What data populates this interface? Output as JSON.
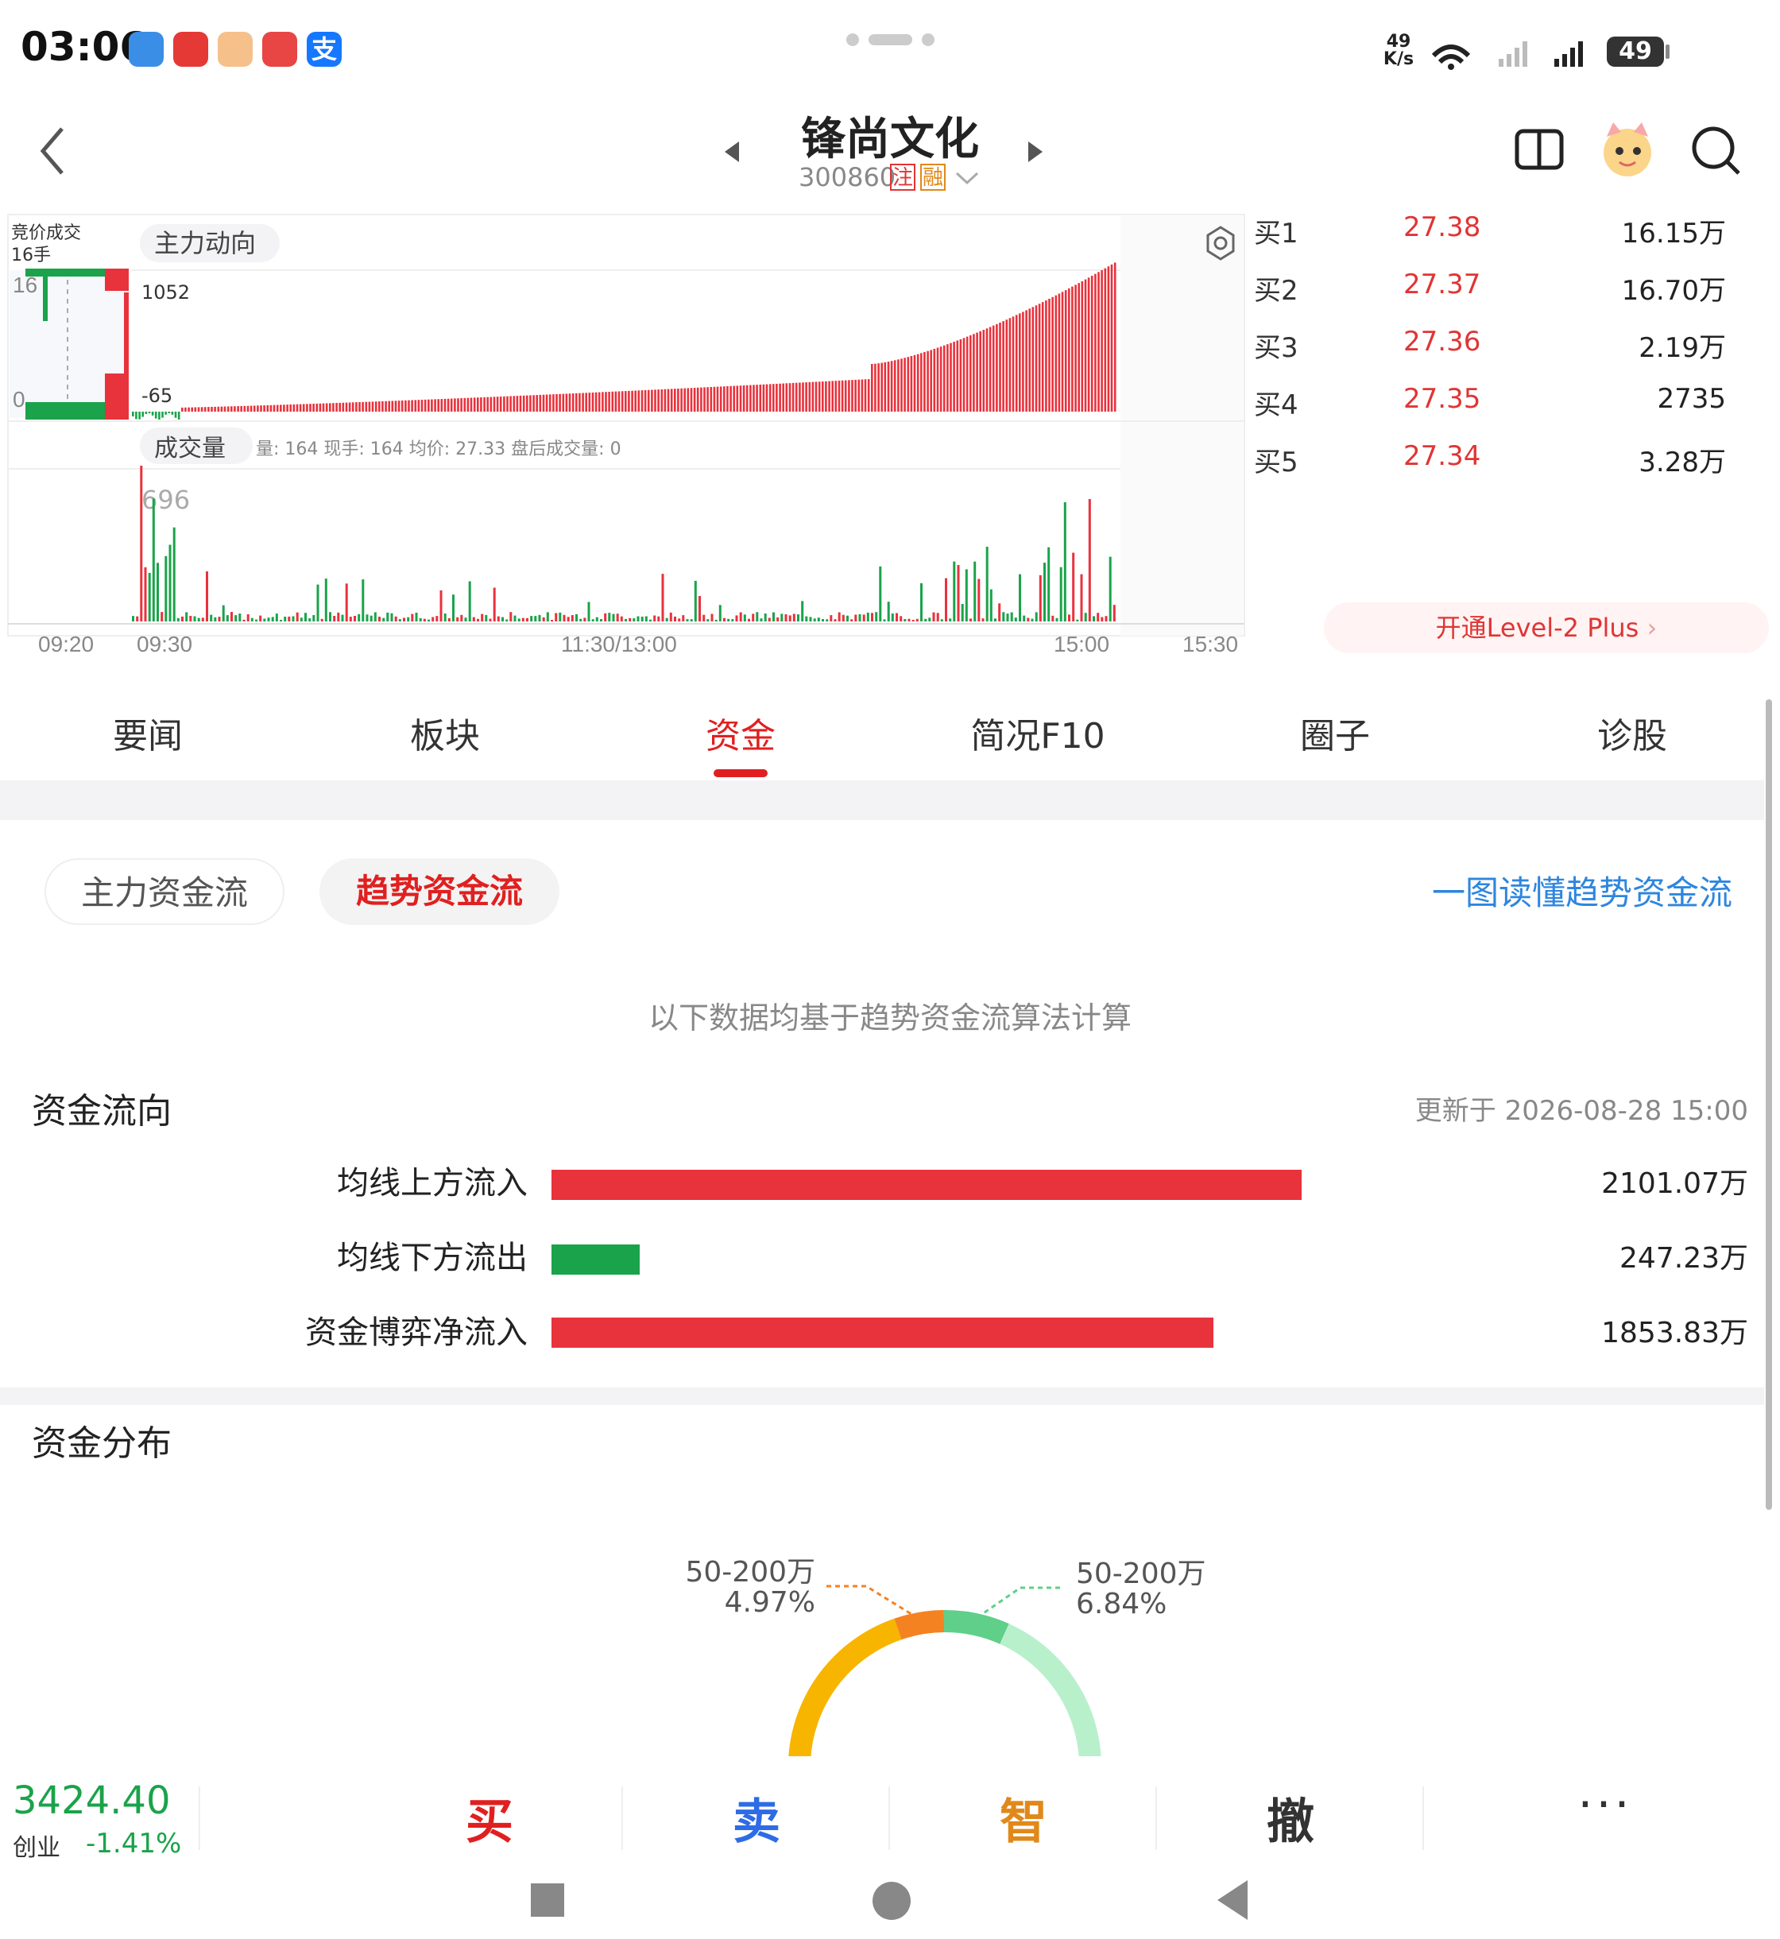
{
  "status_bar": {
    "time": "03:06",
    "net_speed": "49 K/s",
    "battery": "49"
  },
  "header": {
    "stock_name": "锋尚文化",
    "stock_code": "300860",
    "tag_zhu": "注",
    "tag_rong": "融"
  },
  "chart": {
    "auction_label": "竞价成交",
    "auction_volume": "16手",
    "main_flow_label": "主力动向",
    "left_max": "16",
    "left_min": "0",
    "flow_max": "1052",
    "flow_min": "-65",
    "volume_label": "成交量",
    "volume_info": "量: 164 现手: 164 均价: 27.33 盘后成交量: 0",
    "volume_max": "696",
    "time_ticks": [
      "09:20",
      "09:30",
      "11:30/13:00",
      "15:00",
      "15:30"
    ]
  },
  "order_book": [
    {
      "label": "买1",
      "price": "27.38",
      "volume": "16.15万"
    },
    {
      "label": "买2",
      "price": "27.37",
      "volume": "16.70万"
    },
    {
      "label": "买3",
      "price": "27.36",
      "volume": "2.19万"
    },
    {
      "label": "买4",
      "price": "27.35",
      "volume": "2735"
    },
    {
      "label": "买5",
      "price": "27.34",
      "volume": "3.28万"
    }
  ],
  "level2_button": "开通Level-2 Plus",
  "tabs": [
    "要闻",
    "板块",
    "资金",
    "简况F10",
    "圈子",
    "诊股"
  ],
  "active_tab": "资金",
  "toggle": {
    "main_flow": "主力资金流",
    "trend_flow": "趋势资金流",
    "read_link": "一图读懂趋势资金流"
  },
  "note": "以下数据均基于趋势资金流算法计算",
  "money_flow": {
    "title": "资金流向",
    "updated": "更新于 2026-08-28 15:00",
    "rows": [
      {
        "label": "均线上方流入",
        "value": "2101.07万",
        "amount": 2101.07,
        "color": "#e8323c"
      },
      {
        "label": "均线下方流出",
        "value": "247.23万",
        "amount": 247.23,
        "color": "#1aa34a"
      },
      {
        "label": "资金博弈净流入",
        "value": "1853.83万",
        "amount": 1853.83,
        "color": "#e8323c"
      }
    ]
  },
  "distribution": {
    "title": "资金分布",
    "left_label": "50-200万",
    "left_pct": "4.97%",
    "right_label": "50-200万",
    "right_pct": "6.84%"
  },
  "bottom": {
    "index_value": "3424.40",
    "index_name": "创业",
    "index_change": "-1.41%",
    "buy": "买",
    "sell": "卖",
    "smart": "智",
    "cancel": "撤",
    "more": "···"
  },
  "colors": {
    "up": "#e8323c",
    "down": "#1aa34a",
    "accent": "#e02020",
    "link": "#2e86de"
  }
}
